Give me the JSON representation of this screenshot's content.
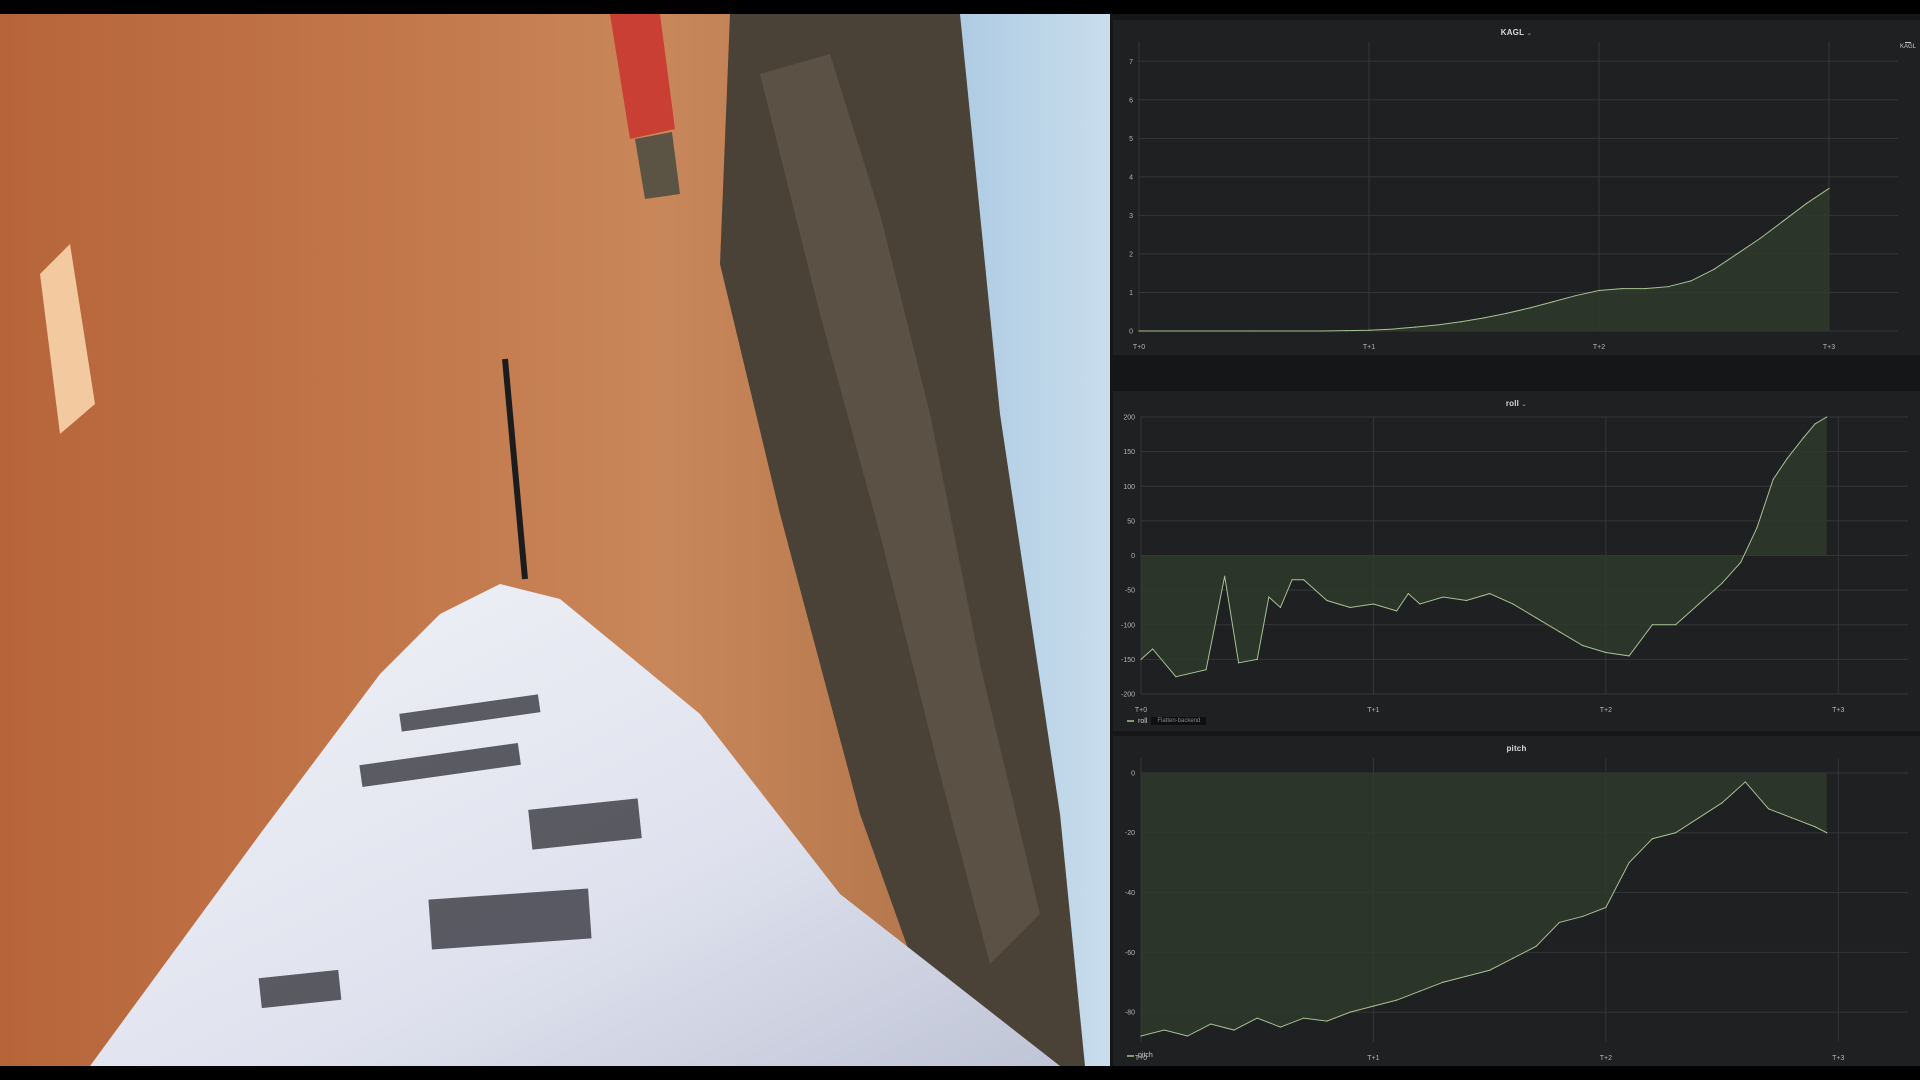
{
  "panels": {
    "kagl": {
      "title": "KAGL",
      "legend": "KAGL",
      "y_ticks": [
        "7",
        "6",
        "5",
        "4",
        "3",
        "2",
        "1",
        "0"
      ],
      "x_ticks": [
        "T+0",
        "T+1",
        "T+2",
        "T+3"
      ]
    },
    "roll": {
      "title": "roll",
      "legend": "roll",
      "legend_tab": "Flatten-backend",
      "y_ticks": [
        "200",
        "150",
        "100",
        "50",
        "0",
        "-50",
        "-100",
        "-150",
        "-200"
      ],
      "x_ticks": [
        "T+0",
        "T+1",
        "T+2",
        "T+3"
      ]
    },
    "pitch": {
      "title": "pitch",
      "legend": "pitch",
      "y_ticks": [
        "0",
        "-20",
        "-40",
        "-60",
        "-80"
      ],
      "x_ticks": [
        "T+0",
        "T+1",
        "T+2",
        "T+3"
      ]
    }
  },
  "colors": {
    "series_line": "#a7c293",
    "series_fill": "#2f3a2a",
    "grid": "#34363a",
    "panel_bg": "#1f2022"
  },
  "chart_data": [
    {
      "type": "area",
      "title": "KAGL",
      "ylim": [
        0,
        7.5
      ],
      "xlim": [
        0,
        3.3
      ],
      "x": [
        0,
        0.5,
        0.8,
        0.9,
        1.0,
        1.1,
        1.2,
        1.3,
        1.4,
        1.5,
        1.6,
        1.7,
        1.8,
        1.9,
        2.0,
        2.1,
        2.2,
        2.3,
        2.4,
        2.5,
        2.6,
        2.7,
        2.8,
        2.9,
        3.0
      ],
      "series": [
        {
          "name": "KAGL",
          "values": [
            0,
            0,
            0,
            0.01,
            0.02,
            0.05,
            0.1,
            0.16,
            0.24,
            0.34,
            0.46,
            0.6,
            0.76,
            0.92,
            1.05,
            1.1,
            1.1,
            1.15,
            1.3,
            1.6,
            2.0,
            2.4,
            2.85,
            3.3,
            3.7
          ]
        }
      ]
    },
    {
      "type": "area",
      "title": "roll",
      "ylim": [
        -200,
        200
      ],
      "xlim": [
        0,
        3.3
      ],
      "x": [
        0,
        0.05,
        0.15,
        0.28,
        0.36,
        0.42,
        0.5,
        0.55,
        0.6,
        0.65,
        0.7,
        0.75,
        0.8,
        0.9,
        1.0,
        1.1,
        1.15,
        1.2,
        1.3,
        1.4,
        1.5,
        1.6,
        1.7,
        1.8,
        1.9,
        2.0,
        2.1,
        2.2,
        2.3,
        2.4,
        2.5,
        2.58,
        2.65,
        2.72,
        2.78,
        2.85,
        2.9,
        2.95
      ],
      "series": [
        {
          "name": "roll",
          "values": [
            -150,
            -135,
            -175,
            -165,
            -30,
            -155,
            -150,
            -60,
            -75,
            -35,
            -35,
            -50,
            -65,
            -75,
            -70,
            -80,
            -55,
            -70,
            -60,
            -65,
            -55,
            -70,
            -90,
            -110,
            -130,
            -140,
            -145,
            -100,
            -100,
            -70,
            -40,
            -10,
            40,
            110,
            140,
            170,
            190,
            200
          ]
        }
      ]
    },
    {
      "type": "area",
      "title": "pitch",
      "ylim": [
        -90,
        5
      ],
      "xlim": [
        0,
        3.3
      ],
      "x": [
        0,
        0.1,
        0.2,
        0.3,
        0.4,
        0.5,
        0.6,
        0.7,
        0.8,
        0.9,
        1.0,
        1.1,
        1.2,
        1.3,
        1.4,
        1.5,
        1.6,
        1.7,
        1.8,
        1.9,
        2.0,
        2.1,
        2.2,
        2.3,
        2.4,
        2.5,
        2.6,
        2.7,
        2.8,
        2.9,
        2.95
      ],
      "series": [
        {
          "name": "pitch",
          "values": [
            -88,
            -86,
            -88,
            -84,
            -86,
            -82,
            -85,
            -82,
            -83,
            -80,
            -78,
            -76,
            -73,
            -70,
            -68,
            -66,
            -62,
            -58,
            -50,
            -48,
            -45,
            -30,
            -22,
            -20,
            -15,
            -10,
            -3,
            -12,
            -15,
            -18,
            -20
          ]
        }
      ]
    }
  ]
}
